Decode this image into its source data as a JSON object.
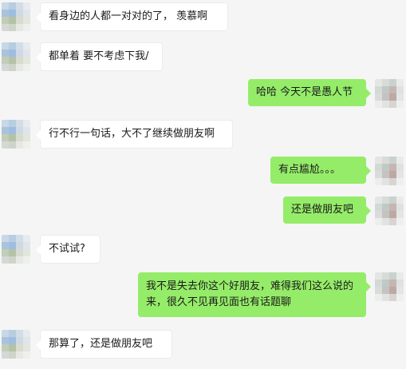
{
  "colors": {
    "background": "#f5f5f5",
    "incoming_bubble": "#ffffff",
    "outgoing_bubble": "#95ec69"
  },
  "messages": [
    {
      "side": "left",
      "text": "看身边的人都一对对的了， 羡慕啊"
    },
    {
      "side": "left",
      "text": "都单着 要不考虑下我/"
    },
    {
      "side": "right",
      "text": "哈哈 今天不是愚人节"
    },
    {
      "side": "left",
      "text": "行不行一句话，大不了继续做朋友啊"
    },
    {
      "side": "right",
      "text": "有点尴尬。。。"
    },
    {
      "side": "right",
      "text": "还是做朋友吧"
    },
    {
      "side": "left",
      "text": "不试试?"
    },
    {
      "side": "right",
      "text": "我不是失去你这个好朋友，难得我们这么说的来，很久不见再见面也有话题聊"
    },
    {
      "side": "left",
      "text": "那算了，还是做朋友吧"
    }
  ]
}
